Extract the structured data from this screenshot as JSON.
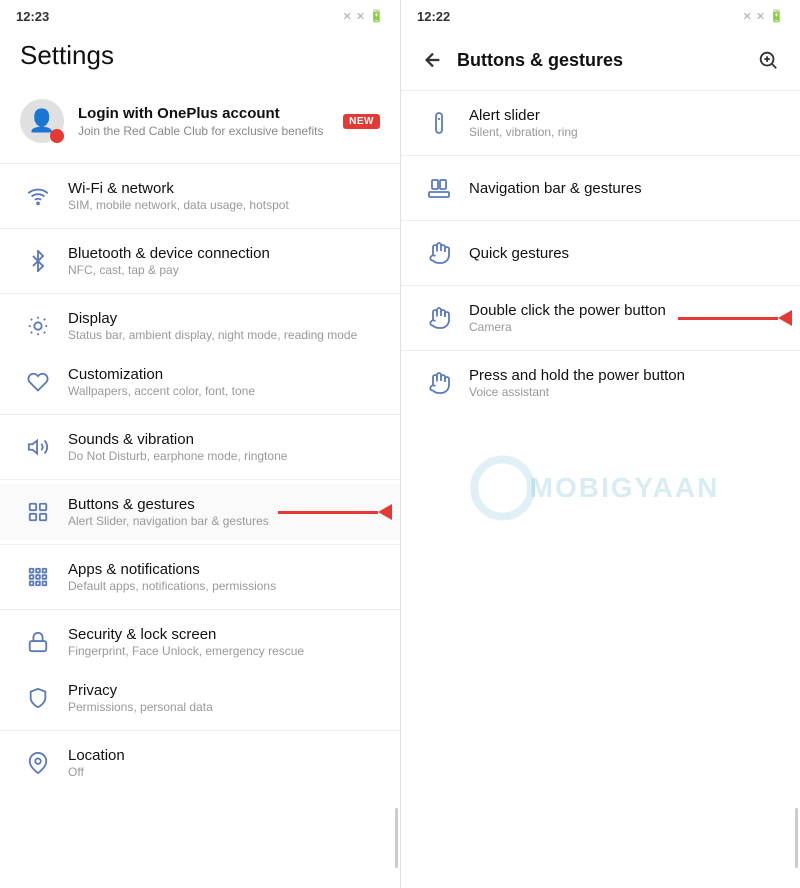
{
  "left_panel": {
    "status_bar": {
      "time": "12:23"
    },
    "header": {
      "title": "Settings"
    },
    "login_card": {
      "title": "Login with OnePlus account",
      "subtitle": "Join the Red Cable Club for exclusive benefits",
      "badge": "NEW"
    },
    "items": [
      {
        "id": "wifi",
        "title": "Wi-Fi & network",
        "subtitle": "SIM, mobile network, data usage, hotspot",
        "icon": "wifi"
      },
      {
        "id": "bluetooth",
        "title": "Bluetooth & device connection",
        "subtitle": "NFC, cast, tap & pay",
        "icon": "bluetooth"
      },
      {
        "id": "display",
        "title": "Display",
        "subtitle": "Status bar, ambient display, night mode, reading mode",
        "icon": "display"
      },
      {
        "id": "customization",
        "title": "Customization",
        "subtitle": "Wallpapers, accent color, font, tone",
        "icon": "customization"
      },
      {
        "id": "sounds",
        "title": "Sounds & vibration",
        "subtitle": "Do Not Disturb, earphone mode, ringtone",
        "icon": "sounds"
      },
      {
        "id": "buttons",
        "title": "Buttons & gestures",
        "subtitle": "Alert Slider, navigation bar & gestures",
        "icon": "buttons",
        "active": true,
        "has_arrow": true
      },
      {
        "id": "apps",
        "title": "Apps & notifications",
        "subtitle": "Default apps, notifications, permissions",
        "icon": "apps"
      },
      {
        "id": "security",
        "title": "Security & lock screen",
        "subtitle": "Fingerprint, Face Unlock, emergency rescue",
        "icon": "security"
      },
      {
        "id": "privacy",
        "title": "Privacy",
        "subtitle": "Permissions, personal data",
        "icon": "privacy"
      },
      {
        "id": "location",
        "title": "Location",
        "subtitle": "Off",
        "icon": "location"
      }
    ]
  },
  "right_panel": {
    "status_bar": {
      "time": "12:22"
    },
    "header": {
      "title": "Buttons & gestures",
      "back_label": "←",
      "search_label": "🔍"
    },
    "items": [
      {
        "id": "alert-slider",
        "title": "Alert slider",
        "subtitle": "Silent, vibration, ring",
        "icon": "alert"
      },
      {
        "id": "navigation",
        "title": "Navigation bar & gestures",
        "subtitle": "",
        "icon": "navigation"
      },
      {
        "id": "quick-gestures",
        "title": "Quick gestures",
        "subtitle": "",
        "icon": "gesture"
      },
      {
        "id": "double-click",
        "title": "Double click the power button",
        "subtitle": "Camera",
        "icon": "power",
        "has_arrow": true
      },
      {
        "id": "press-hold",
        "title": "Press and hold the power button",
        "subtitle": "Voice assistant",
        "icon": "power-hold"
      }
    ]
  },
  "watermark": {
    "text": "MOBIGYAAN"
  }
}
